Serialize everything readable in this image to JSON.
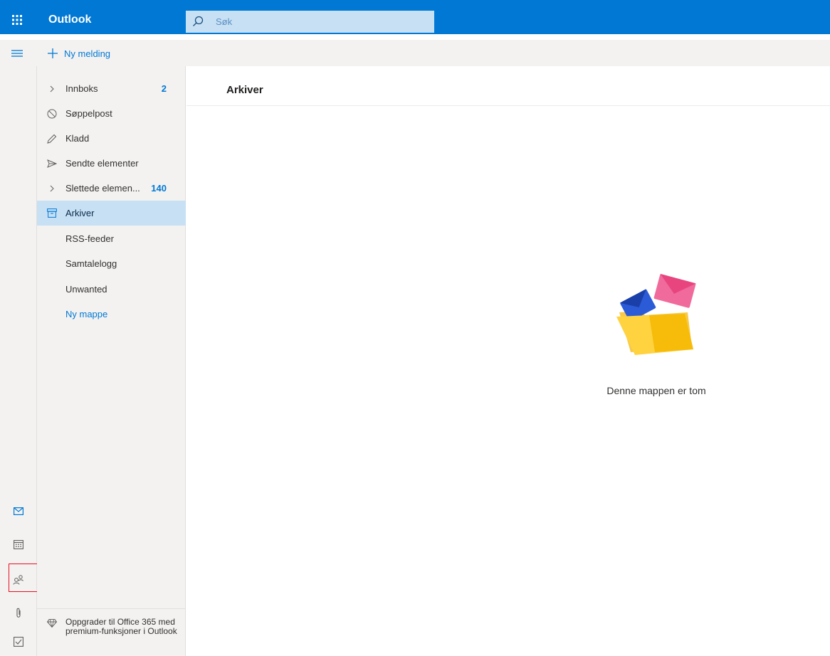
{
  "app": {
    "title": "Outlook"
  },
  "search": {
    "placeholder": "Søk"
  },
  "commandbar": {
    "new_message_label": "Ny melding"
  },
  "folders": [
    {
      "label": "Innboks",
      "count": "2",
      "icon": "chevron-right-icon"
    },
    {
      "label": "Søppelpost",
      "count": "",
      "icon": "blocked-icon"
    },
    {
      "label": "Kladd",
      "count": "",
      "icon": "pencil-icon"
    },
    {
      "label": "Sendte elementer",
      "count": "",
      "icon": "send-icon"
    },
    {
      "label": "Slettede elemen...",
      "count": "140",
      "icon": "chevron-right-icon"
    },
    {
      "label": "Arkiver",
      "count": "",
      "icon": "archive-icon",
      "selected": true
    },
    {
      "label": "RSS-feeder",
      "count": ""
    },
    {
      "label": "Samtalelogg",
      "count": ""
    },
    {
      "label": "Unwanted",
      "count": ""
    },
    {
      "label": "Ny mappe",
      "count": "",
      "link": true
    }
  ],
  "upgrade": {
    "text": "Oppgrader til Office 365 med premium-funksjoner i Outlook",
    "icon": "diamond-icon"
  },
  "rail": [
    "mail-icon",
    "calendar-icon",
    "people-icon",
    "attachment-icon",
    "todo-icon"
  ],
  "main": {
    "title": "Arkiver",
    "empty_text": "Denne mappen er tom"
  },
  "colors": {
    "accent": "#0078d4",
    "selected_bg": "#c7e0f4",
    "pane_bg": "#f3f2f1",
    "highlight": "#e81123"
  }
}
